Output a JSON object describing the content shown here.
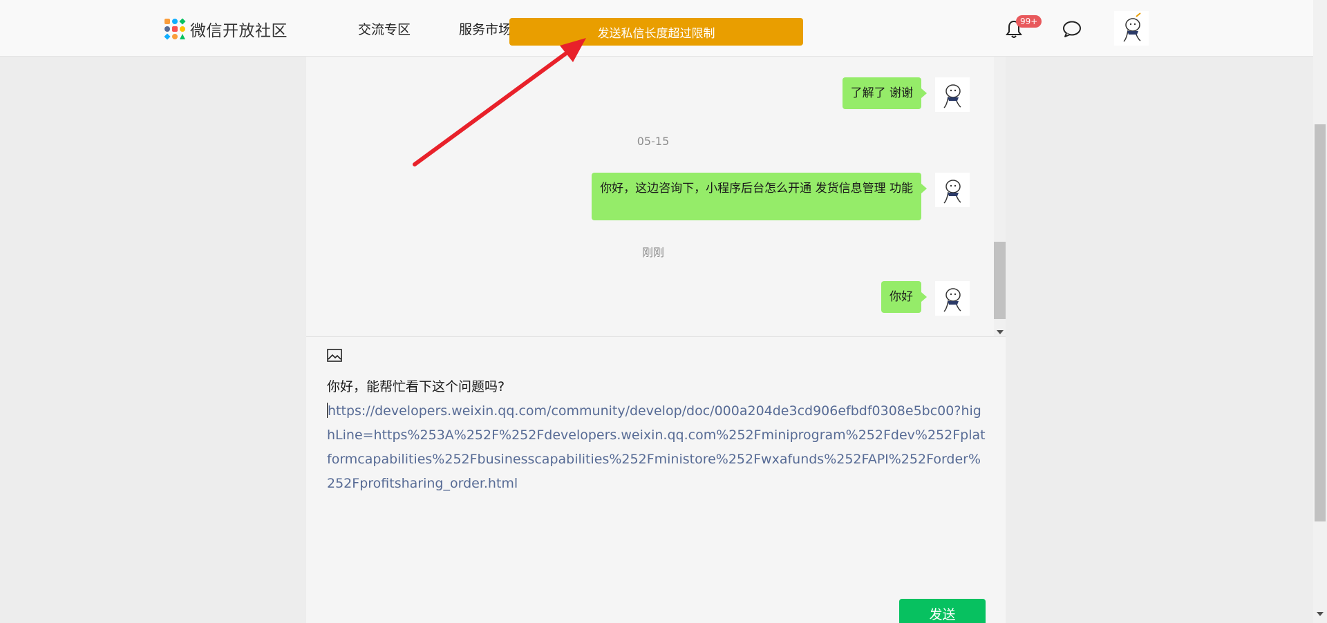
{
  "nav": {
    "logo_text": "微信开放社区",
    "items": [
      {
        "label": "交流专区"
      },
      {
        "label": "服务市场"
      }
    ],
    "notification_badge": "99+",
    "icons": [
      "bell-icon",
      "chat-bubble-icon"
    ]
  },
  "banner": {
    "text": "发送私信长度超过限制",
    "color": "#e99e00"
  },
  "chat": {
    "messages": [
      {
        "type": "bubble",
        "text": "了解了 谢谢"
      },
      {
        "type": "timestamp",
        "text": "05-15"
      },
      {
        "type": "bubble",
        "text": "你好，这边咨询下，小程序后台怎么开通 发货信息管理 功能"
      },
      {
        "type": "timestamp",
        "text": "刚刚"
      },
      {
        "type": "bubble",
        "text": "你好"
      }
    ],
    "bubble_color": "#95ec69"
  },
  "composer": {
    "line1": "你好，能帮忙看下这个问题吗?",
    "link": "https://developers.weixin.qq.com/community/develop/doc/000a204de3cd906efbdf0308e5bc00?highLine=https%253A%252F%252Fdevelopers.weixin.qq.com%252Fminiprogram%252Fdev%252Fplatformcapabilities%252Fbusinesscapabilities%252Fministore%252Fwxafunds%252FAPI%252Forder%252Fprofitsharing_order.html",
    "send_label": "发送",
    "send_color": "#07c160",
    "link_color": "#576b95"
  },
  "annotation": {
    "color": "#e8212a",
    "type": "arrow"
  }
}
